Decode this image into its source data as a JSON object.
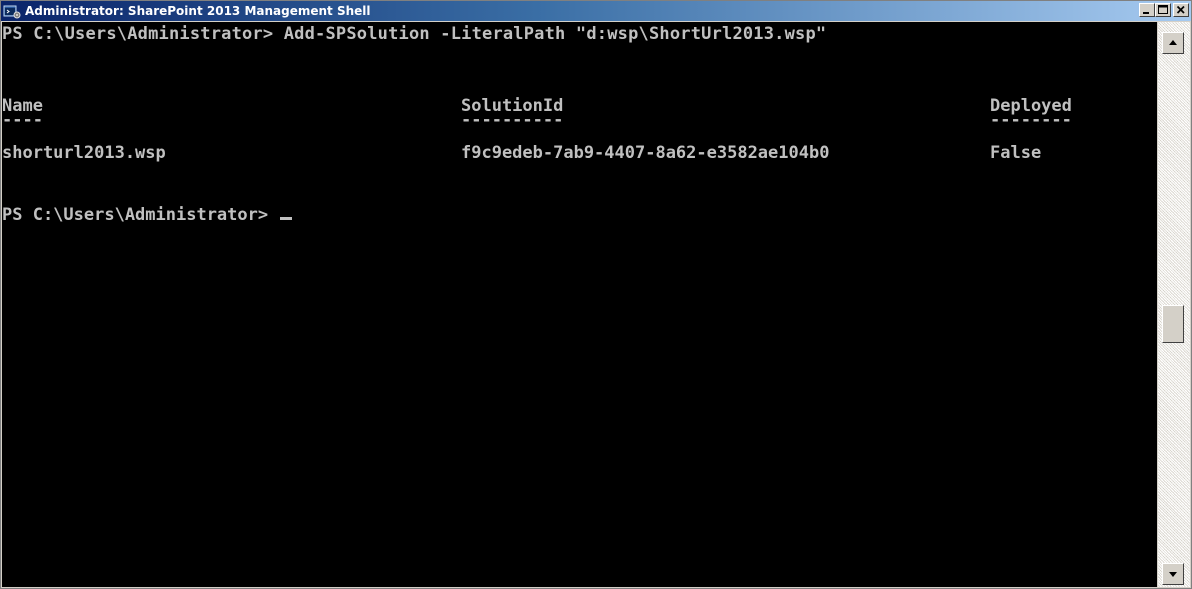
{
  "window": {
    "title": "Administrator: SharePoint 2013 Management Shell"
  },
  "console": {
    "command_line": "PS C:\\Users\\Administrator> Add-SPSolution -LiteralPath \"d:wsp\\ShortUrl2013.wsp\"",
    "table": {
      "headers": [
        "Name",
        "SolutionId",
        "Deployed"
      ],
      "underline": [
        "----",
        "----------",
        "--------"
      ],
      "rows": [
        [
          "shorturl2013.wsp",
          "f9c9edeb-7ab9-4407-8a62-e3582ae104b0",
          "False"
        ]
      ]
    },
    "prompt": "PS C:\\Users\\Administrator> "
  },
  "icons": {
    "app": "powershell-app-icon",
    "minimize": "minimize-icon",
    "maximize": "maximize-icon",
    "close": "close-icon",
    "scroll_up": "arrow-up-icon",
    "scroll_down": "arrow-down-icon"
  },
  "colors": {
    "console_bg": "#000000",
    "console_fg": "#c0c0c0",
    "titlebar_start": "#0a246a",
    "titlebar_end": "#a6caf0"
  }
}
